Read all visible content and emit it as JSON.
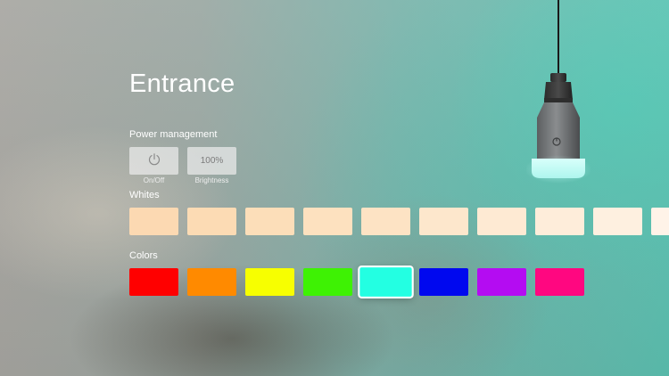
{
  "room": {
    "title": "Entrance"
  },
  "power": {
    "section_label": "Power management",
    "onoff_label": "On/Off",
    "brightness_value": "100%",
    "brightness_label": "Brightness"
  },
  "whites": {
    "section_label": "Whites",
    "swatches": [
      "#fcd9b2",
      "#fcdbb4",
      "#fcdeb9",
      "#fde1bf",
      "#fde3c4",
      "#fde7cc",
      "#feead3",
      "#feedda",
      "#fef0e0",
      "#fff3e8"
    ]
  },
  "colors": {
    "section_label": "Colors",
    "selected_index": 4,
    "swatches": [
      "#ff0000",
      "#ff8a00",
      "#f7ff00",
      "#3ef204",
      "#23ffe2",
      "#0008ef",
      "#b40cf2",
      "#ff0780"
    ]
  },
  "icons": {
    "power": "power-icon",
    "bulb": "lightbulb-icon"
  }
}
